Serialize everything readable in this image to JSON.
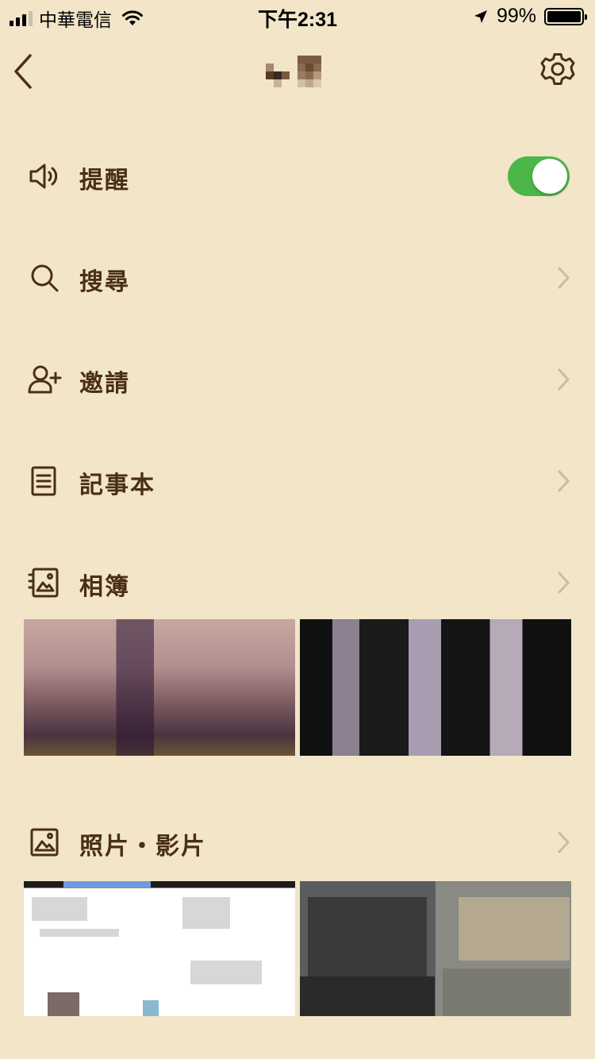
{
  "status_bar": {
    "carrier": "中華電信",
    "time": "下午2:31",
    "battery_text": "99%",
    "battery_level": 0.99,
    "signal_bars": 4,
    "signal_filled": 3
  },
  "nav": {
    "back_icon": "chevron-left-icon",
    "settings_icon": "gear-icon"
  },
  "menu": {
    "reminder": {
      "label": "提醒",
      "icon": "speaker-icon",
      "toggle_on": true
    },
    "search": {
      "label": "搜尋",
      "icon": "search-icon"
    },
    "invite": {
      "label": "邀請",
      "icon": "add-user-icon"
    },
    "notes": {
      "label": "記事本",
      "icon": "note-icon"
    },
    "album": {
      "label": "相簿",
      "icon": "album-icon"
    },
    "media": {
      "label": "照片・影片",
      "icon": "image-icon"
    }
  },
  "colors": {
    "background": "#f2e5c8",
    "text": "#4a2f14",
    "toggle_on": "#4cb748",
    "chevron": "#c8bca3"
  }
}
